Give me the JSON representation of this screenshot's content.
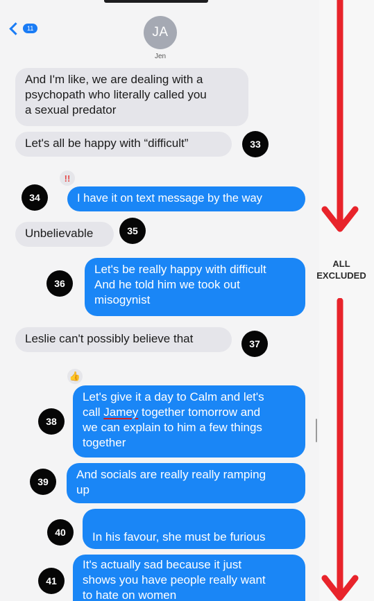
{
  "header": {
    "avatar_initials": "JA",
    "contact_name": "Jen",
    "back_badge": "11"
  },
  "messages": [
    {
      "lines": [
        "And I'm like, we are dealing with a",
        "psychopath who literally called you",
        "a sexual predator"
      ]
    },
    {
      "lines": [
        "Let's all be happy with “difficult”"
      ],
      "number": "33"
    },
    {
      "lines": [
        "I have it on text message by the way"
      ],
      "number": "34",
      "tapback": "!!"
    },
    {
      "lines": [
        "Unbelievable"
      ],
      "number": "35"
    },
    {
      "lines": [
        "Let's be really happy with difficult",
        "And he told him we took out",
        "misogynist"
      ],
      "number": "36"
    },
    {
      "lines": [
        "Leslie can't possibly believe that"
      ],
      "number": "37"
    },
    {
      "lines_pre": "Let's give it a day to Calm and let's",
      "line2_before": "call ",
      "line2_underlined": "Jamey",
      "line2_after": " together tomorrow and",
      "lines_post": [
        "we can explain to him a few things",
        "together"
      ],
      "number": "38",
      "tapback": "👍"
    },
    {
      "lines": [
        "And socials are really really ramping",
        "up"
      ],
      "number": "39"
    },
    {
      "lines": [
        "In his favour, she must be furious"
      ],
      "number": "40"
    },
    {
      "lines": [
        "It's actually sad because it just",
        "shows you have people really want",
        "to hate on women"
      ],
      "number": "41"
    }
  ],
  "annotation": {
    "line1": "ALL",
    "line2": "EXCLUDED"
  },
  "colors": {
    "sent_bubble": "#1a86f6",
    "received_bubble": "#e5e5ea",
    "arrow": "#e8242b",
    "number_badge": "#060606"
  }
}
